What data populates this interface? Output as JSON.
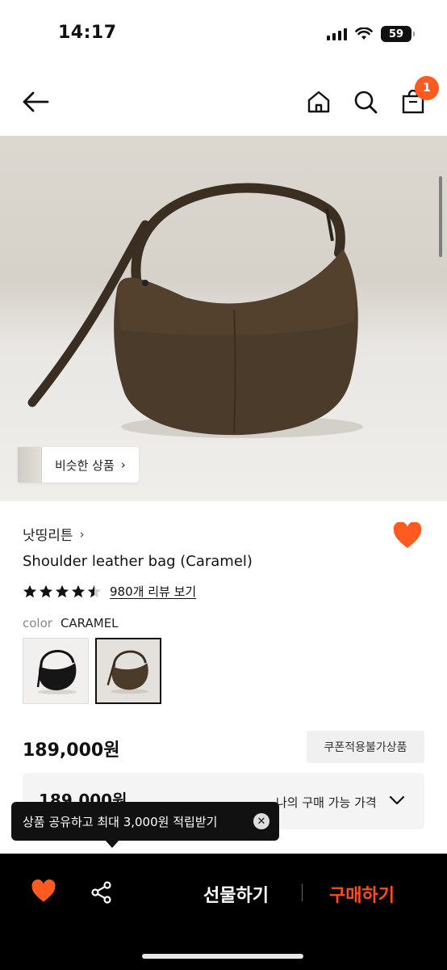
{
  "status": {
    "time": "14:17",
    "battery": "59"
  },
  "nav": {
    "cart_count": "1"
  },
  "hero": {
    "similar_label": "비슷한 상품"
  },
  "product": {
    "brand": "낫띵리튼",
    "title": "Shoulder leather bag (Caramel)",
    "rating": 4.5,
    "review_link": "980개 리뷰 보기",
    "color_label": "color",
    "color_value": "CARAMEL",
    "price": "189,000원",
    "coupon_note": "쿠폰적용불가상품",
    "my_price_value": "189,000원",
    "my_price_label": "나의 구매 가능 가격"
  },
  "tooltip": {
    "text": "상품 공유하고 최대 3,000원 적립받기"
  },
  "bottom_bar": {
    "gift_label": "선물하기",
    "buy_label": "구매하기"
  },
  "colors": {
    "accent": "#ff5a1f",
    "heart": "#ff5a1f",
    "buy": "#ff4d1f"
  }
}
